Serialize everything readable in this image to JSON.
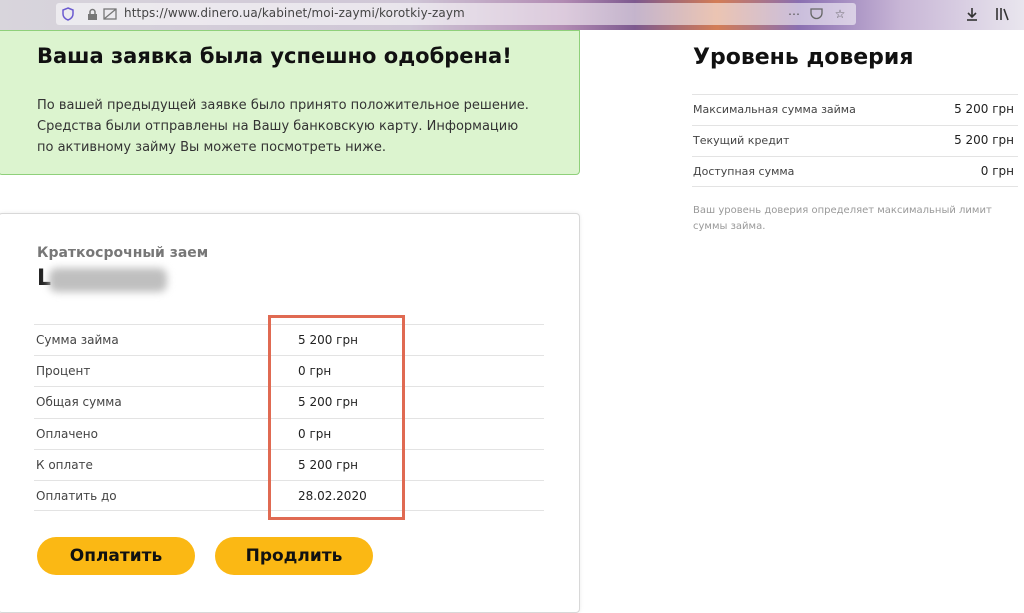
{
  "browser": {
    "url": "https://www.dinero.ua/kabinet/moi-zaymi/korotkiy-zaym"
  },
  "success": {
    "title": "Ваша заявка была успешно одобрена!",
    "text": "По вашей предыдущей заявке было принято положительное решение. Средства были отправлены на Вашу банковскую карту. Информацию по активному займу Вы можете посмотреть ниже."
  },
  "loan": {
    "type": "Краткосрочный заем",
    "number_prefix": "L",
    "rows": [
      {
        "label": "Сумма займа",
        "value": "5 200 грн"
      },
      {
        "label": "Процент",
        "value": "0 грн"
      },
      {
        "label": "Общая сумма",
        "value": "5 200 грн"
      },
      {
        "label": "Оплачено",
        "value": "0 грн"
      },
      {
        "label": "К оплате",
        "value": "5 200 грн"
      },
      {
        "label": "Оплатить до",
        "value": "28.02.2020"
      }
    ],
    "pay_label": "Оплатить",
    "extend_label": "Продлить"
  },
  "trust": {
    "title": "Уровень доверия",
    "rows": [
      {
        "label": "Максимальная сумма займа",
        "value": "5 200 грн"
      },
      {
        "label": "Текущий кредит",
        "value": "5 200 грн"
      },
      {
        "label": "Доступная сумма",
        "value": "0 грн"
      }
    ],
    "note": "Ваш уровень доверия определяет максимальный лимит суммы займа."
  },
  "colors": {
    "accent": "#fbb814",
    "success_bg": "#dcf4cf",
    "highlight": "#e06a52"
  }
}
